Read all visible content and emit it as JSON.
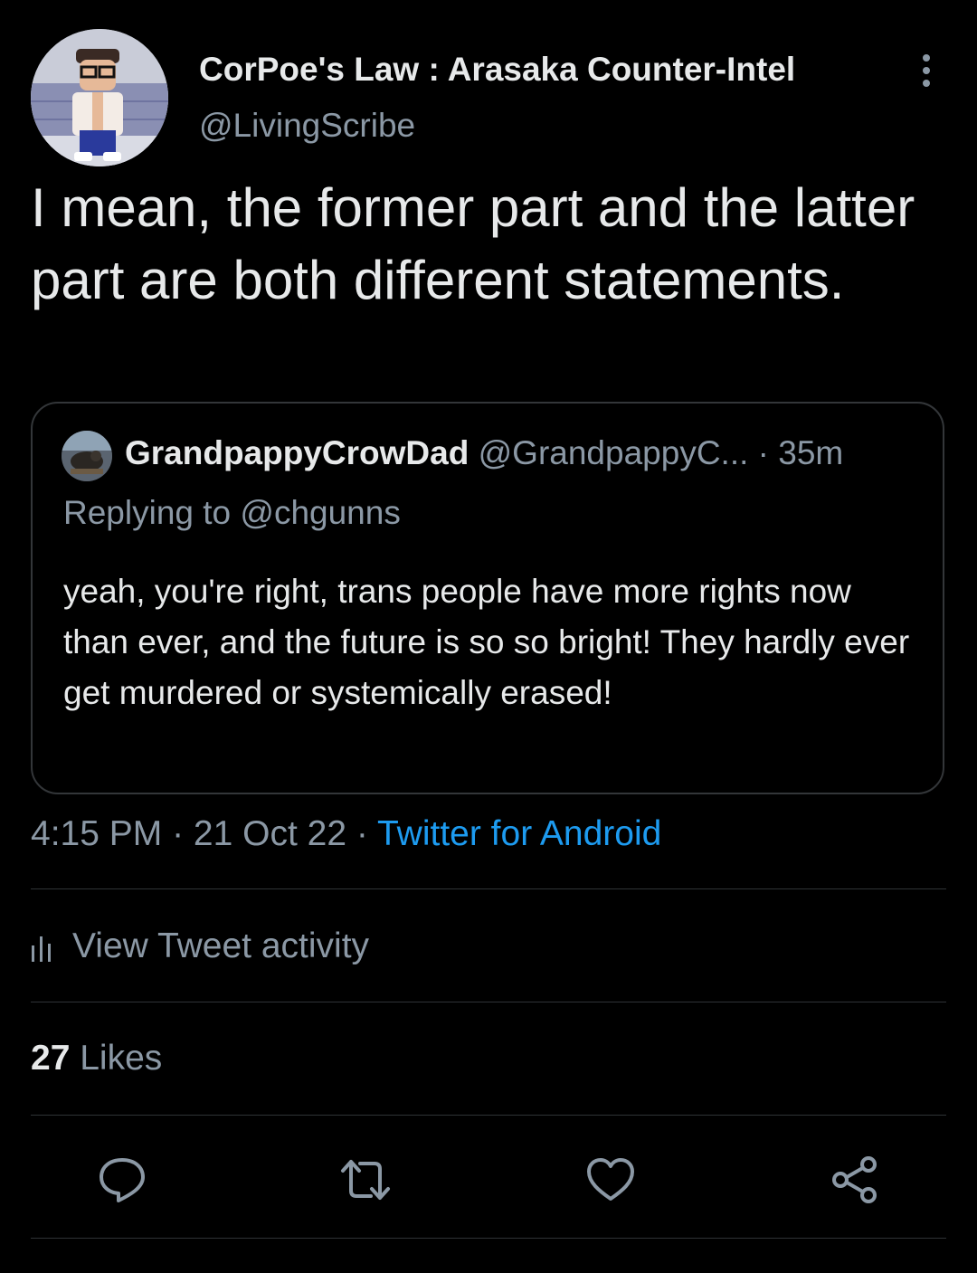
{
  "author": {
    "display_name": "CorPoe's Law : Arasaka Counter-Intel",
    "handle": "@LivingScribe"
  },
  "tweet": {
    "text": "I mean, the former part and the latter part are both different statements."
  },
  "quoted": {
    "display_name": "GrandpappyCrowDad",
    "handle": "@GrandpappyC...",
    "time": "35m",
    "replying_to": "Replying to @chgunns",
    "text": "yeah, you're right, trans people have more rights now than ever, and the future is so so bright! They hardly ever get murdered or systemically erased!"
  },
  "meta": {
    "time": "4:15 PM",
    "date": "21 Oct 22",
    "source": "Twitter for Android"
  },
  "activity_label": "View Tweet activity",
  "likes": {
    "count": "27",
    "label": "Likes"
  },
  "actions": [
    "reply-icon",
    "retweet-icon",
    "like-icon",
    "share-icon"
  ],
  "colors": {
    "background": "#000000",
    "text": "#e7e9ea",
    "secondary": "#8b98a5",
    "link": "#1d9bf0",
    "divider": "#2f3336"
  }
}
